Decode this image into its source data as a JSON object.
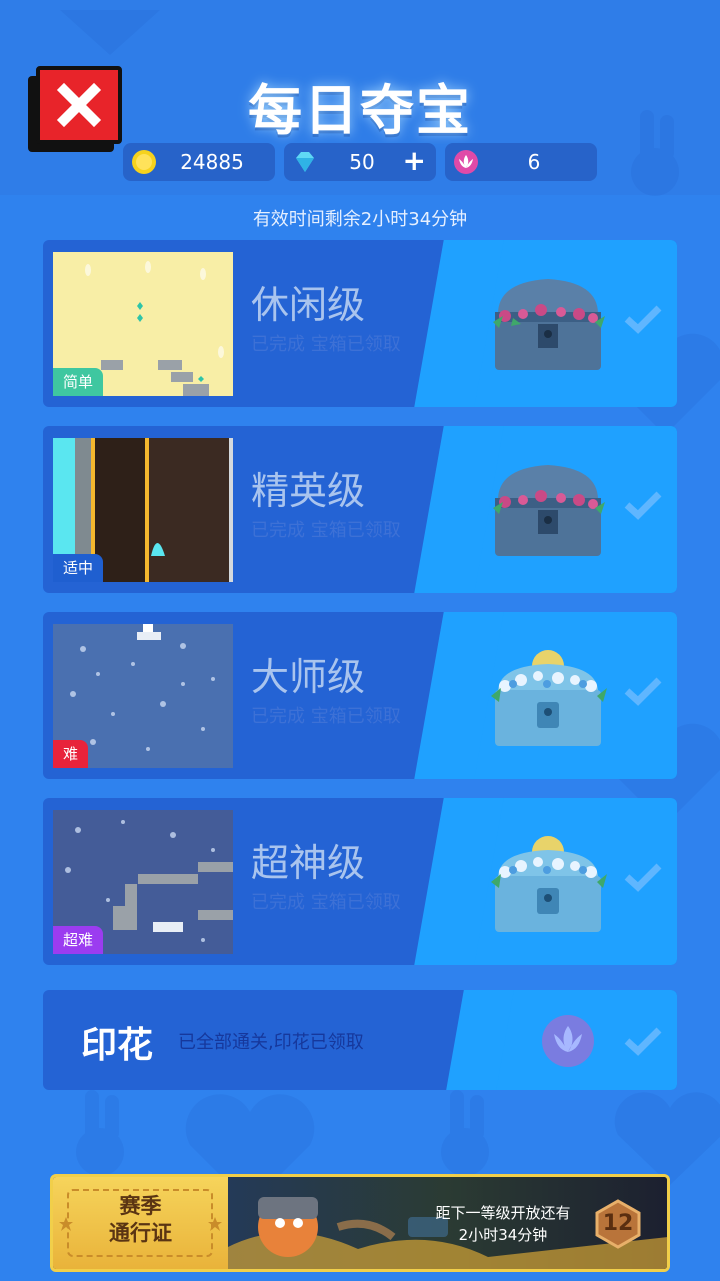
{
  "header": {
    "title": "每日夺宝",
    "currencies": [
      {
        "icon": "coin-icon",
        "value": "24885"
      },
      {
        "icon": "diamond-icon",
        "value": "50",
        "add_label": "+"
      },
      {
        "icon": "lotus-icon",
        "value": "6"
      }
    ]
  },
  "timer_text": "有效时间剩余2小时34分钟",
  "levels": [
    {
      "name": "休闲级",
      "status": "已完成 宝箱已领取",
      "difficulty": "简单",
      "badge_color": "#3fc7a0"
    },
    {
      "name": "精英级",
      "status": "已完成 宝箱已领取",
      "difficulty": "适中",
      "badge_color": "#1f5fd0"
    },
    {
      "name": "大师级",
      "status": "已完成 宝箱已领取",
      "difficulty": "难",
      "badge_color": "#e8233b"
    },
    {
      "name": "超神级",
      "status": "已完成 宝箱已领取",
      "difficulty": "超难",
      "badge_color": "#9b3cf0"
    }
  ],
  "stamp": {
    "title": "印花",
    "status": "已全部通关,印花已领取"
  },
  "season_pass": {
    "label_line1": "赛季",
    "label_line2": "通行证",
    "next_line1": "距下一等级开放还有",
    "next_line2": "2小时34分钟",
    "level": "12"
  }
}
